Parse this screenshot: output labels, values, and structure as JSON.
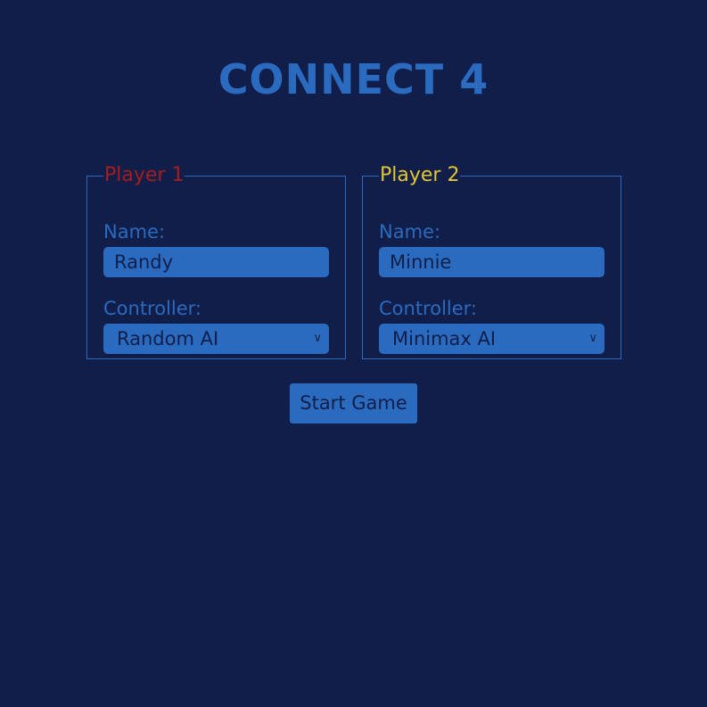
{
  "title": "CONNECT 4",
  "colors": {
    "background": "#111e4a",
    "accent": "#2a6bbf",
    "player1": "#a51d1d",
    "player2": "#e0c534"
  },
  "players": [
    {
      "legend": "Player 1",
      "name_label": "Name:",
      "name_value": "Randy",
      "controller_label": "Controller:",
      "controller_value": "Random AI"
    },
    {
      "legend": "Player 2",
      "name_label": "Name:",
      "name_value": "Minnie",
      "controller_label": "Controller:",
      "controller_value": "Minimax AI"
    }
  ],
  "start_button": "Start Game",
  "icons": {
    "select_arrow": "chevron-down-icon"
  }
}
